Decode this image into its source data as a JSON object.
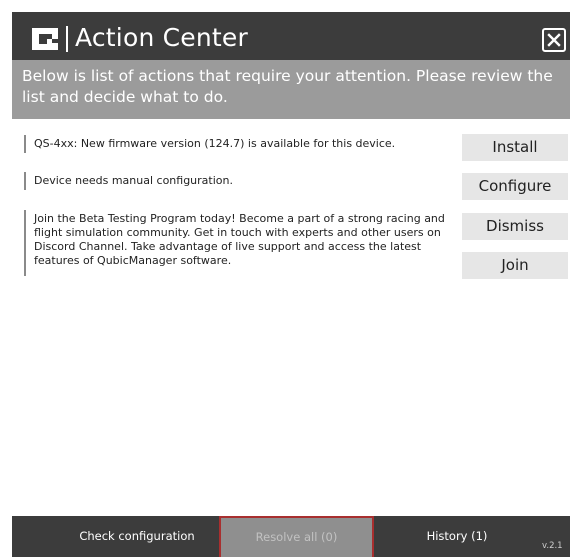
{
  "window": {
    "title": "Action Center",
    "logo_icon": "qubic-logo-icon",
    "close_icon": "close-x-icon"
  },
  "banner": {
    "text": "Below is list of actions that require your attention. Please review the list and decide what to do."
  },
  "actions": {
    "messages": [
      "QS-4xx: New firmware version (124.7) is available for this device.",
      "Device needs manual configuration.",
      "Join the Beta Testing Program today! Become a part of a strong racing and flight simulation community. Get in touch with experts and other users on Discord Channel. Take advantage of live support and access the latest features of QubicManager software."
    ],
    "buttons": {
      "install": "Install",
      "configure": "Configure",
      "dismiss": "Dismiss",
      "join": "Join"
    }
  },
  "footer": {
    "check_configuration": "Check configuration",
    "resolve_all": "Resolve all (0)",
    "history": "History (1)",
    "version": "v.2.1"
  },
  "colors": {
    "titlebar": "#3c3c3c",
    "banner": "#9b9b9b",
    "button": "#e6e6e6",
    "resolve_disabled": "#8f8f8f",
    "resolve_border": "#a82f2f"
  }
}
